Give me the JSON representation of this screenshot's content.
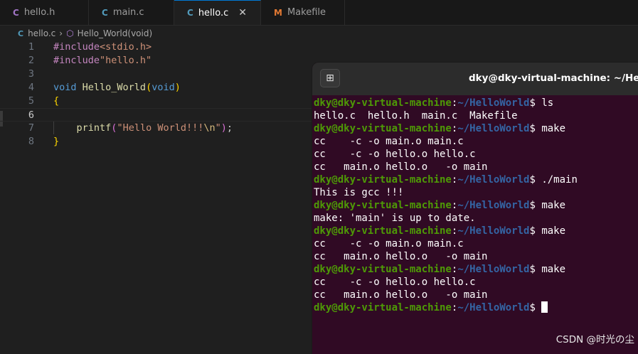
{
  "tabs": [
    {
      "icon": "C",
      "label": "hello.h"
    },
    {
      "icon": "C",
      "label": "main.c"
    },
    {
      "icon": "C",
      "label": "hello.c",
      "close": "✕"
    },
    {
      "icon": "M",
      "label": "Makefile"
    }
  ],
  "breadcrumb": {
    "file_icon": "C",
    "file": "hello.c",
    "symbol": "Hello_World(void)"
  },
  "editor": {
    "line_numbers": [
      "1",
      "2",
      "3",
      "4",
      "5",
      "6",
      "7",
      "8"
    ],
    "l1": {
      "directive": "#include",
      "header": "<stdio.h>"
    },
    "l2": {
      "directive": "#include",
      "header": "\"hello.h\""
    },
    "l4": {
      "ret": "void",
      "name": "Hello_World",
      "open": "(",
      "param": "void",
      "close": ")"
    },
    "l5": {
      "brace": "{"
    },
    "l7": {
      "fn": "printf",
      "open": "(",
      "str1": "\"Hello World!!!",
      "esc": "\\n",
      "str2": "\"",
      "close": ")",
      "semi": ";"
    },
    "l8": {
      "brace": "}"
    }
  },
  "terminal": {
    "new_tab_icon": "⊞",
    "title": "dky@dky-virtual-machine: ~/HelloWorld",
    "prompt_user": "dky@dky-virtual-machine",
    "prompt_colon": ":",
    "prompt_path": "~/HelloWorld",
    "prompt_dollar": "$ ",
    "lines": [
      {
        "type": "cmd",
        "text": "ls"
      },
      {
        "type": "out",
        "text": "hello.c  hello.h  main.c  Makefile"
      },
      {
        "type": "cmd",
        "text": "make"
      },
      {
        "type": "out",
        "text": "cc    -c -o main.o main.c"
      },
      {
        "type": "out",
        "text": "cc    -c -o hello.o hello.c"
      },
      {
        "type": "out",
        "text": "cc   main.o hello.o   -o main"
      },
      {
        "type": "cmd",
        "text": "./main"
      },
      {
        "type": "out",
        "text": "This is gcc !!!"
      },
      {
        "type": "cmd",
        "text": "make"
      },
      {
        "type": "out",
        "text": "make: 'main' is up to date."
      },
      {
        "type": "cmd",
        "text": "make"
      },
      {
        "type": "out",
        "text": "cc    -c -o main.o main.c"
      },
      {
        "type": "out",
        "text": "cc   main.o hello.o   -o main"
      },
      {
        "type": "cmd",
        "text": "make"
      },
      {
        "type": "out",
        "text": "cc    -c -o hello.o hello.c"
      },
      {
        "type": "out",
        "text": "cc   main.o hello.o   -o main"
      },
      {
        "type": "cmd",
        "text": ""
      }
    ]
  },
  "watermark": "CSDN @时光の尘"
}
